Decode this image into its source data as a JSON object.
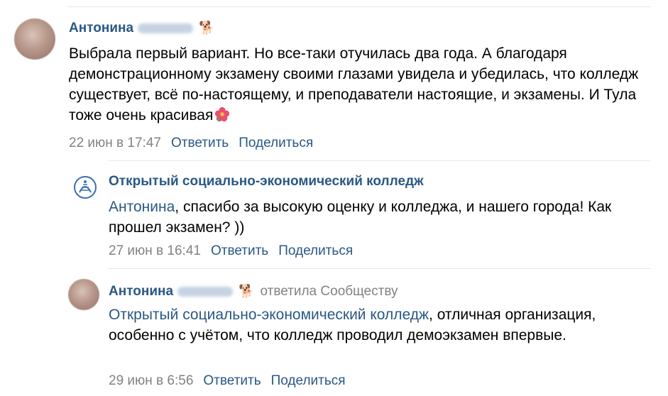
{
  "comments": [
    {
      "author": "Антонина",
      "pet_icon": "dog-emoji-icon",
      "text": "Выбрала первый вариант. Но все-таки отучилась два года. А благодаря демонстрационному экзамену своими глазами увидела и убедилась, что колледж существует, всё по-настоящему, и преподаватели настоящие, и экзамены. И Тула тоже очень красивая",
      "emoji": "hibiscus-icon",
      "date": "22 июн в 17:47",
      "reply": "Ответить",
      "share": "Поделиться"
    },
    {
      "author": "Открытый социально-экономический колледж",
      "logo_icon": "college-logo-icon",
      "mention": "Антонина",
      "text": ", спасибо за высокую оценку и колледжа, и нашего города! Как прошел экзамен? ))",
      "date": "27 июн в 16:41",
      "reply": "Ответить",
      "share": "Поделиться"
    },
    {
      "author": "Антонина",
      "pet_icon": "dog-emoji-icon",
      "replied_to": "ответила Сообществу",
      "mention": "Открытый социально-экономический колледж",
      "text": ", отличная организация, особенно с учётом, что колледж проводил демоэкзамен впервые.",
      "date": "29 июн в 6:56",
      "reply": "Ответить",
      "share": "Поделиться"
    }
  ],
  "colors": {
    "link": "#2a5885",
    "meta": "#828282",
    "separator": "#e7e8ec"
  }
}
